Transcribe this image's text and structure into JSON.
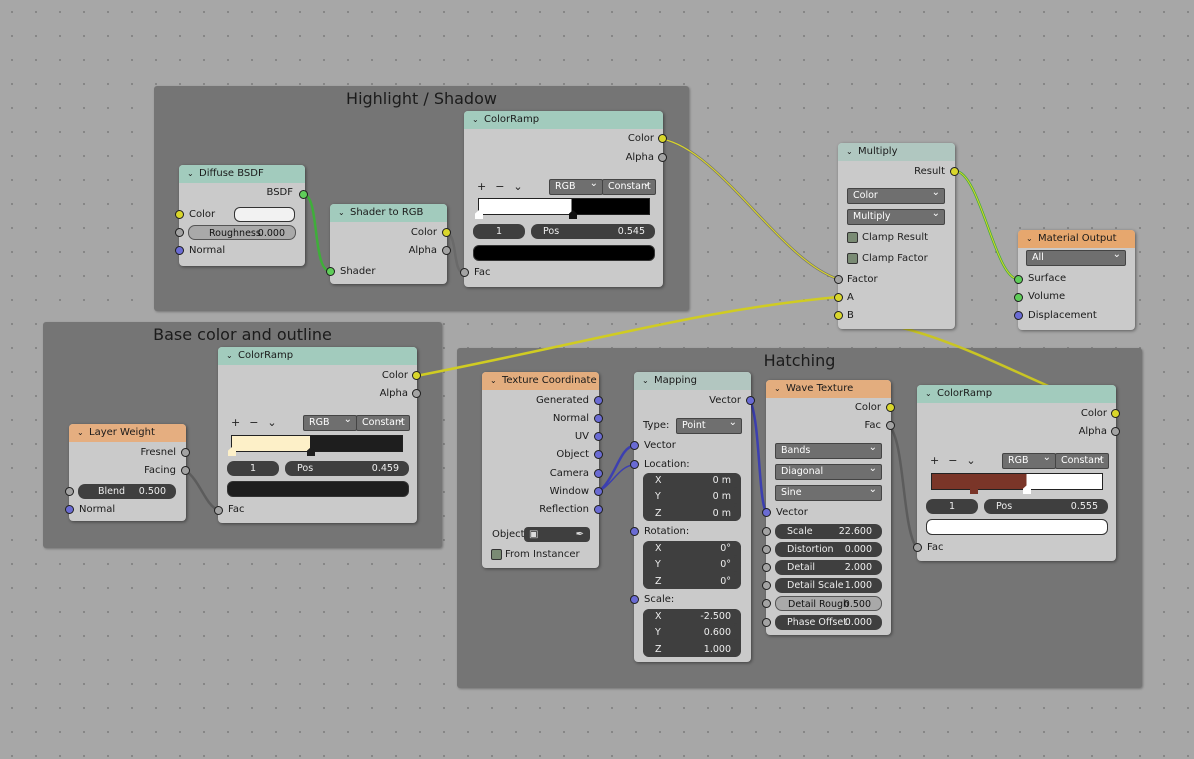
{
  "frames": {
    "highlight": "Highlight / Shadow",
    "base": "Base color and outline",
    "hatching": "Hatching"
  },
  "diffuse": {
    "title": "Diffuse BSDF",
    "out_bsdf": "BSDF",
    "in_color": "Color",
    "roughness_label": "Roughness",
    "roughness_value": "0.000",
    "in_normal": "Normal",
    "color_swatch": "#f2f2f2"
  },
  "shader_to_rgb": {
    "title": "Shader to RGB",
    "out_color": "Color",
    "out_alpha": "Alpha",
    "in_shader": "Shader"
  },
  "ramp_top": {
    "title": "ColorRamp",
    "out_color": "Color",
    "out_alpha": "Alpha",
    "tools": "+−⌄",
    "mode": "RGB",
    "interp": "Constant",
    "index": "1",
    "pos_label": "Pos",
    "pos_value": "0.545",
    "in_fac": "Fac",
    "stop_color": "#000000"
  },
  "multiply": {
    "title": "Multiply",
    "out_result": "Result",
    "blend_type": "Color",
    "operation": "Multiply",
    "clamp_result": "Clamp Result",
    "clamp_factor": "Clamp Factor",
    "in_factor": "Factor",
    "in_a": "A",
    "in_b": "B"
  },
  "material_output": {
    "title": "Material Output",
    "target": "All",
    "in_surface": "Surface",
    "in_volume": "Volume",
    "in_displacement": "Displacement"
  },
  "layer_weight": {
    "title": "Layer Weight",
    "out_fresnel": "Fresnel",
    "out_facing": "Facing",
    "blend_label": "Blend",
    "blend_value": "0.500",
    "in_normal": "Normal"
  },
  "ramp_base": {
    "title": "ColorRamp",
    "out_color": "Color",
    "out_alpha": "Alpha",
    "tools": "+−⌄",
    "mode": "RGB",
    "interp": "Constant",
    "index": "1",
    "pos_label": "Pos",
    "pos_value": "0.459",
    "in_fac": "Fac",
    "color_a": "#fdf0c8",
    "stop_color": "#1e1e1e"
  },
  "tex_coord": {
    "title": "Texture Coordinate",
    "outputs": [
      "Generated",
      "Normal",
      "UV",
      "Object",
      "Camera",
      "Window",
      "Reflection"
    ],
    "object_label": "Object:",
    "from_instancer": "From Instancer"
  },
  "mapping": {
    "title": "Mapping",
    "out_vector": "Vector",
    "type_label": "Type:",
    "type_value": "Point",
    "in_vector": "Vector",
    "location_label": "Location:",
    "location": [
      {
        "k": "X",
        "v": "0 m"
      },
      {
        "k": "Y",
        "v": "0 m"
      },
      {
        "k": "Z",
        "v": "0 m"
      }
    ],
    "rotation_label": "Rotation:",
    "rotation": [
      {
        "k": "X",
        "v": "0°"
      },
      {
        "k": "Y",
        "v": "0°"
      },
      {
        "k": "Z",
        "v": "0°"
      }
    ],
    "scale_label": "Scale:",
    "scale": [
      {
        "k": "X",
        "v": "-2.500"
      },
      {
        "k": "Y",
        "v": "0.600"
      },
      {
        "k": "Z",
        "v": "1.000"
      }
    ]
  },
  "wave": {
    "title": "Wave Texture",
    "out_color": "Color",
    "out_fac": "Fac",
    "type": "Bands",
    "direction": "Diagonal",
    "profile": "Sine",
    "in_vector": "Vector",
    "params": [
      {
        "k": "Scale",
        "v": "22.600"
      },
      {
        "k": "Distortion",
        "v": "0.000"
      },
      {
        "k": "Detail",
        "v": "2.000"
      },
      {
        "k": "Detail Scale",
        "v": "1.000"
      },
      {
        "k": "Detail Rough",
        "v": "0.500"
      },
      {
        "k": "Phase Offset",
        "v": "0.000"
      }
    ]
  },
  "ramp_hatch": {
    "title": "ColorRamp",
    "out_color": "Color",
    "out_alpha": "Alpha",
    "tools": "+−⌄",
    "mode": "RGB",
    "interp": "Constant",
    "index": "1",
    "pos_label": "Pos",
    "pos_value": "0.555",
    "in_fac": "Fac",
    "color_a": "#7a3528",
    "stop_color": "#ffffff"
  },
  "colors": {
    "wire_color": "#d0cc22",
    "wire_shader": "#3fae3a",
    "wire_vector": "#3c3fb0",
    "wire_gray": "#5f5f5f"
  }
}
